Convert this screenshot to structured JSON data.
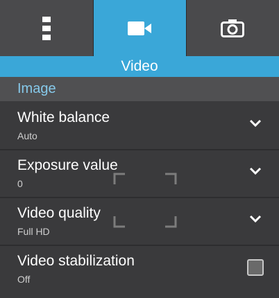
{
  "tabs": [
    {
      "icon": "menu-dots-icon",
      "active": false
    },
    {
      "icon": "video-camera-icon",
      "active": true
    },
    {
      "icon": "photo-camera-icon",
      "active": false
    }
  ],
  "mode_label": "Video",
  "section_title": "Image",
  "settings": [
    {
      "title": "White balance",
      "value": "Auto",
      "control": "chevron-down-icon"
    },
    {
      "title": "Exposure value",
      "value": "0",
      "control": "chevron-down-icon"
    },
    {
      "title": "Video quality",
      "value": "Full HD",
      "control": "chevron-down-icon"
    },
    {
      "title": "Video stabilization",
      "value": "Off",
      "control": "checkbox",
      "checked": false
    }
  ],
  "colors": {
    "accent": "#3aa7d8",
    "section_text": "#86c9ea",
    "background": "#3a3a3c"
  }
}
